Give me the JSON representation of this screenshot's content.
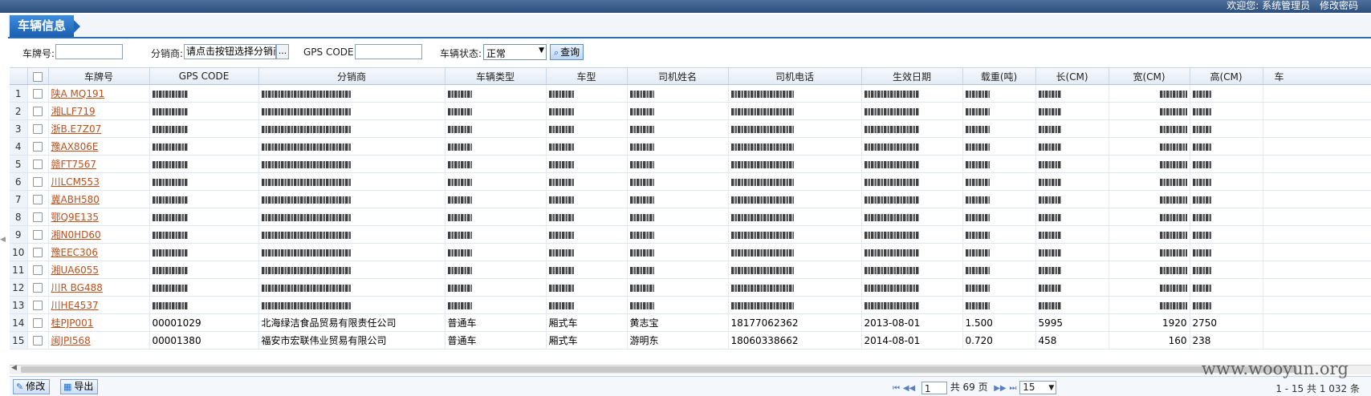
{
  "header": {
    "welcome": "欢迎您: 系统管理员",
    "change_password": "修改密码"
  },
  "panel": {
    "title": "车辆信息"
  },
  "filters": {
    "plate_label": "车牌号:",
    "plate_value": "",
    "distributor_label": "分销商:",
    "distributor_value": "请点击按钮选择分销商",
    "distributor_pick": "...",
    "gps_label": "GPS CODE:",
    "gps_value": "",
    "status_label": "车辆状态:",
    "status_value": "正常",
    "search_label": "查询"
  },
  "table": {
    "columns": [
      "车牌号",
      "GPS CODE",
      "分销商",
      "车辆类型",
      "车型",
      "司机姓名",
      "司机电话",
      "生效日期",
      "载重(吨)",
      "长(CM)",
      "宽(CM)",
      "高(CM)",
      "车"
    ],
    "rows": [
      {
        "num": "1",
        "plate": "陕A MQ191"
      },
      {
        "num": "2",
        "plate": "湘LLF719"
      },
      {
        "num": "3",
        "plate": "浙B.E7Z07"
      },
      {
        "num": "4",
        "plate": "豫AX806E"
      },
      {
        "num": "5",
        "plate": "赣FT7567"
      },
      {
        "num": "6",
        "plate": "川LCM553"
      },
      {
        "num": "7",
        "plate": "冀ABH580"
      },
      {
        "num": "8",
        "plate": "鄂Q9E135"
      },
      {
        "num": "9",
        "plate": "湘N0HD60"
      },
      {
        "num": "10",
        "plate": "豫EEC306"
      },
      {
        "num": "11",
        "plate": "湘UA6055"
      },
      {
        "num": "12",
        "plate": "川R BG488"
      },
      {
        "num": "13",
        "plate": "川HE4537"
      },
      {
        "num": "14",
        "plate": "桂PJP001",
        "gps": "00001029",
        "distributor": "北海绿洁食品贸易有限责任公司",
        "type": "普通车",
        "model": "厢式车",
        "driver": "黄志宝",
        "phone": "18177062362",
        "date": "2013-08-01",
        "load": "1.500",
        "length": "5995",
        "width": "1920",
        "height": "2750"
      },
      {
        "num": "15",
        "plate": "闽JPI568",
        "gps": "00001380",
        "distributor": "福安市宏联伟业贸易有限公司",
        "type": "普通车",
        "model": "厢式车",
        "driver": "游明东",
        "phone": "18060338662",
        "date": "2014-08-01",
        "load": "0.720",
        "length": "458",
        "width": "160",
        "height": "238"
      }
    ]
  },
  "footer": {
    "edit_label": "修改",
    "export_label": "导出",
    "page_value": "1",
    "page_total": "共 69 页",
    "page_size": "15",
    "summary": "1 - 15   共 1 032 条"
  },
  "watermark": "www.wooyun.org"
}
